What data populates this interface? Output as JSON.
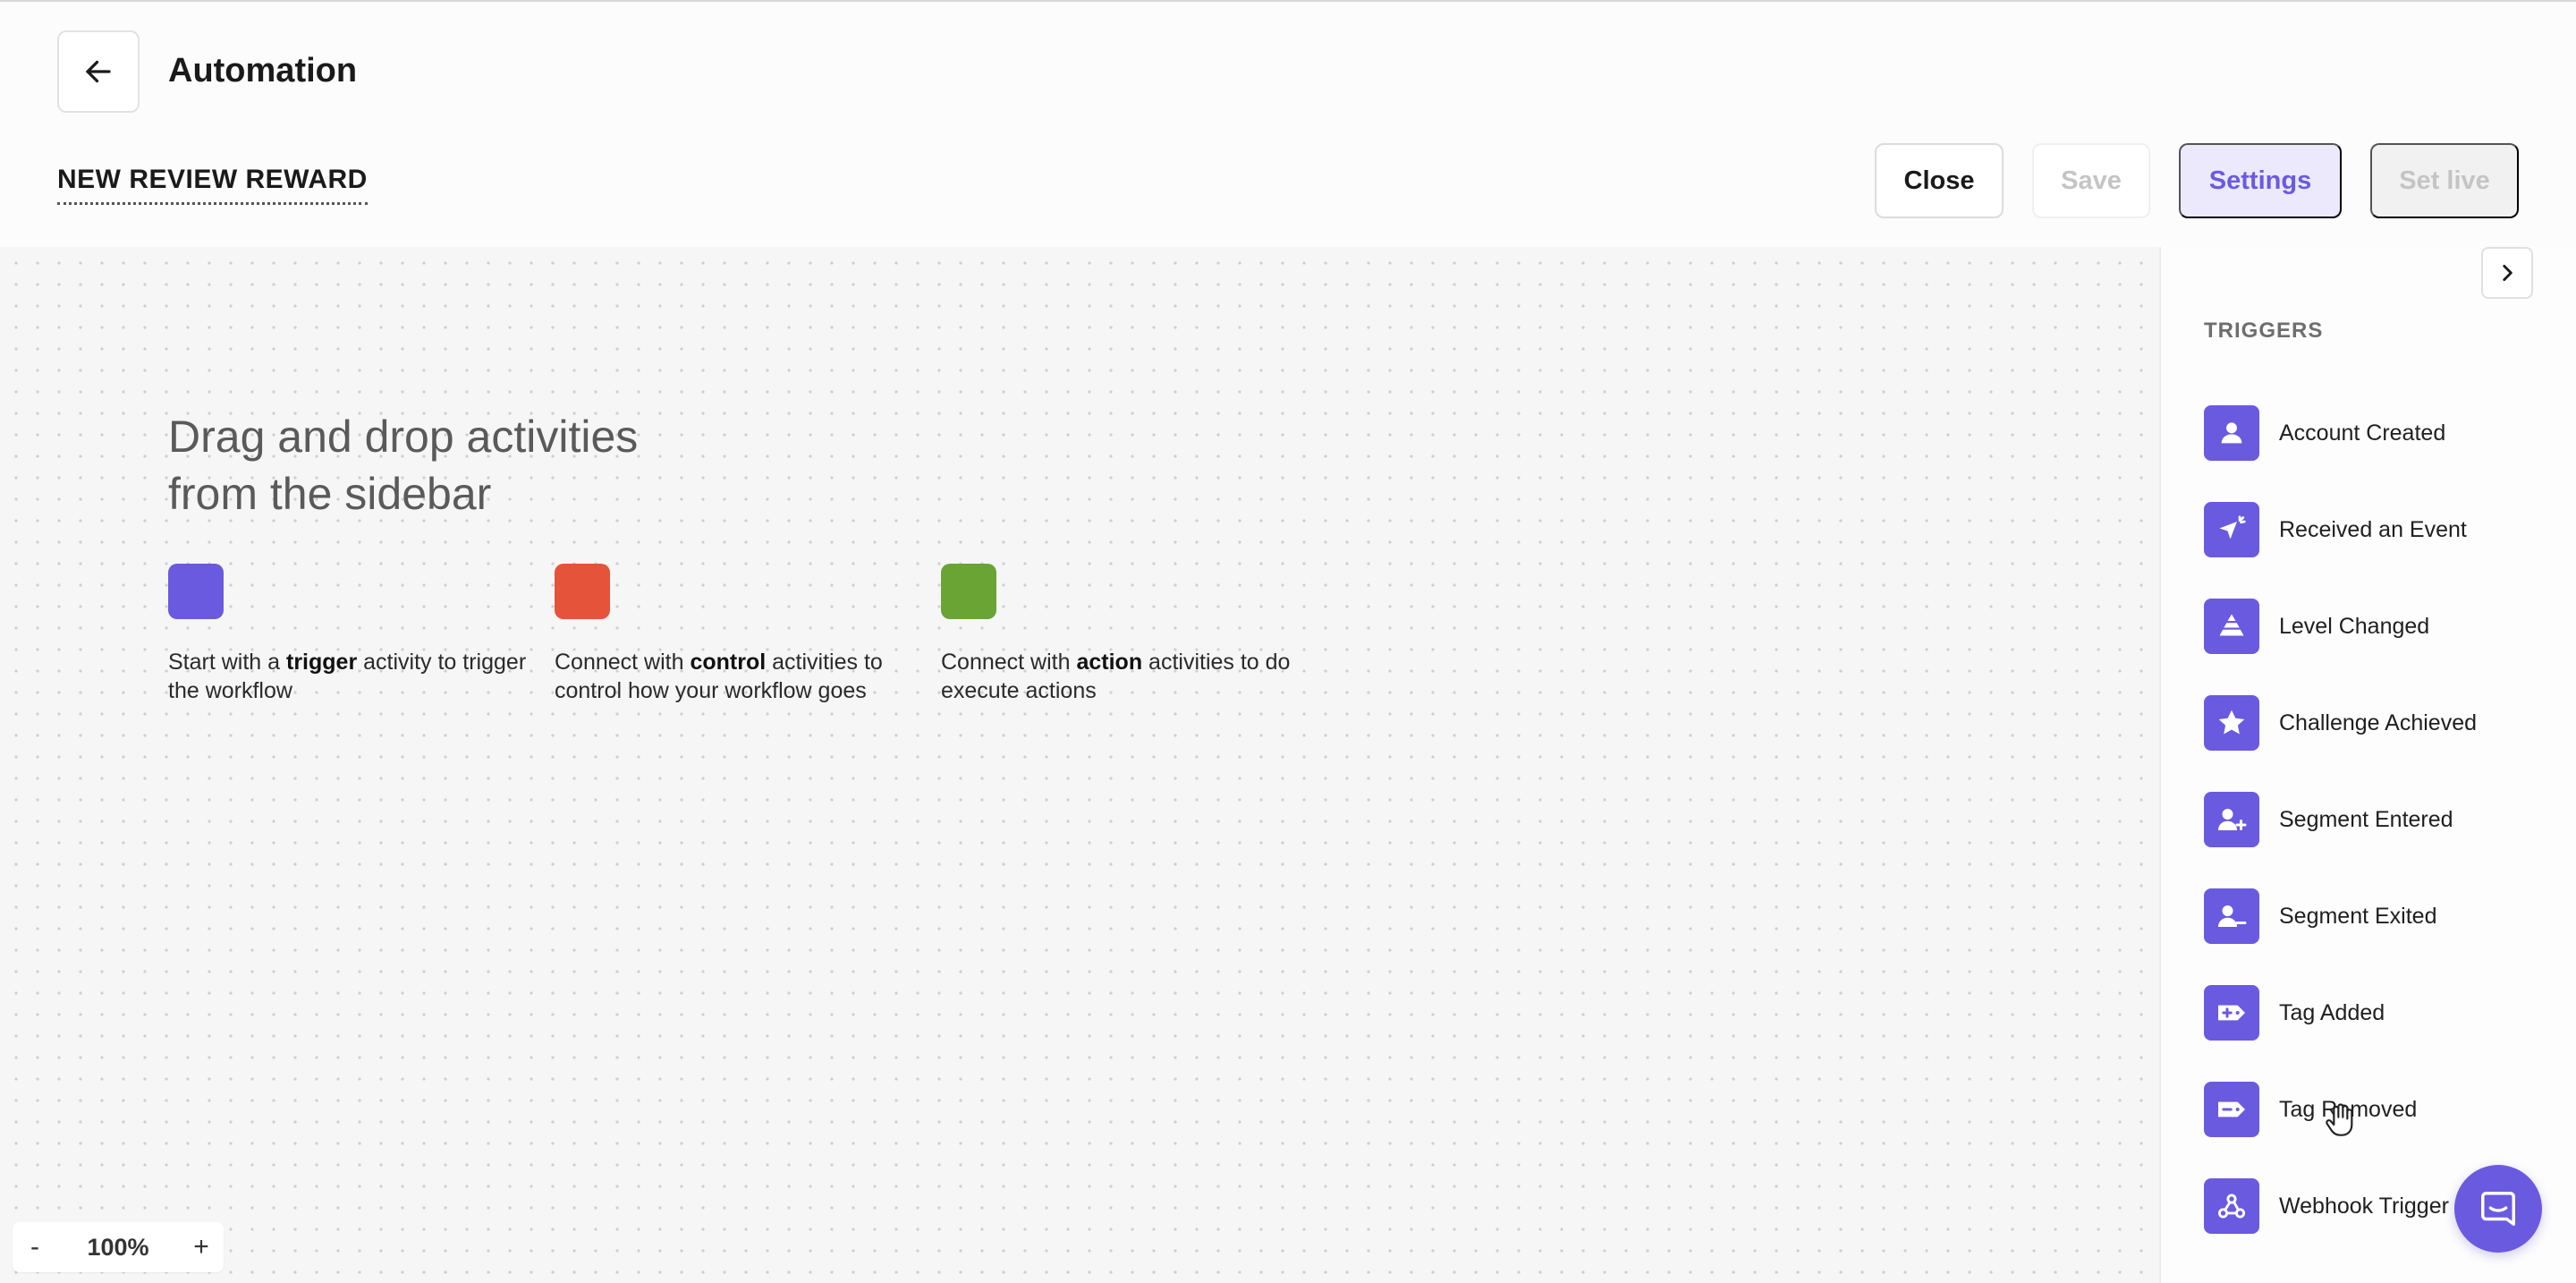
{
  "header": {
    "title": "Automation",
    "workflow_name": "NEW REVIEW REWARD",
    "buttons": {
      "close": "Close",
      "save": "Save",
      "settings": "Settings",
      "set_live": "Set live"
    }
  },
  "canvas": {
    "intro_title_line1": "Drag and drop activities",
    "intro_title_line2": "from the sidebar",
    "hints": [
      {
        "color": "#6a5ae0",
        "prefix": "Start with a ",
        "bold": "trigger",
        "suffix": " activity to trigger the workflow"
      },
      {
        "color": "#e5533a",
        "prefix": "Connect with ",
        "bold": "control",
        "suffix": " activities to control how your workflow goes"
      },
      {
        "color": "#6aa434",
        "prefix": "Connect with ",
        "bold": "action",
        "suffix": " activities to do execute actions"
      }
    ],
    "zoom": {
      "minus": "-",
      "level": "100%",
      "plus": "+"
    }
  },
  "sidebar": {
    "section_title": "TRIGGERS",
    "items": [
      {
        "label": "Account Created",
        "icon": "user-icon"
      },
      {
        "label": "Received an Event",
        "icon": "event-pointer-icon"
      },
      {
        "label": "Level Changed",
        "icon": "level-pyramid-icon"
      },
      {
        "label": "Challenge Achieved",
        "icon": "star-icon"
      },
      {
        "label": "Segment Entered",
        "icon": "user-plus-icon"
      },
      {
        "label": "Segment Exited",
        "icon": "user-minus-icon"
      },
      {
        "label": "Tag Added",
        "icon": "tag-plus-icon"
      },
      {
        "label": "Tag Removed",
        "icon": "tag-minus-icon"
      },
      {
        "label": "Webhook Trigger",
        "icon": "webhook-icon"
      }
    ]
  },
  "colors": {
    "accent": "#6a5ae0",
    "trigger": "#6a5ae0",
    "control": "#e5533a",
    "action": "#6aa434"
  }
}
